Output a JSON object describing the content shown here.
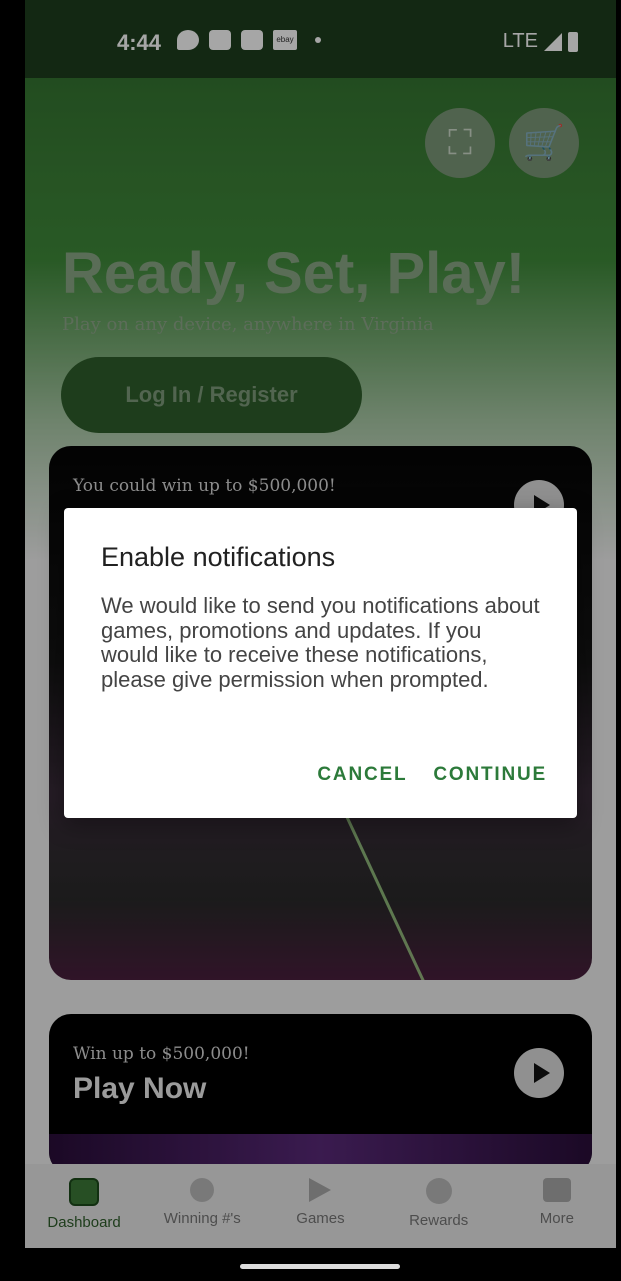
{
  "status_bar": {
    "time": "4:44",
    "network": "LTE",
    "icons": [
      "chat-bubble-icon",
      "message-icon",
      "app-icon",
      "ebay-icon"
    ],
    "ebay_label": "ebay"
  },
  "header": {
    "scan_icon": "scan-icon",
    "cart_icon": "cart-icon"
  },
  "hero": {
    "title": "Ready, Set, Play!",
    "subtitle": "Play on any device, anywhere in Virginia",
    "login_label": "Log In / Register"
  },
  "cards": [
    {
      "kicker": "You could win up to $500,000!",
      "title": ""
    },
    {
      "kicker": "Win up to $500,000!",
      "title": "Play Now"
    }
  ],
  "dialog": {
    "title": "Enable notifications",
    "body": "We would like to send you notifications about games, promotions and updates. If you would like to receive these notifications, please give permission when prompted.",
    "cancel_label": "CANCEL",
    "continue_label": "CONTINUE"
  },
  "bottom_nav": [
    {
      "label": "Dashboard",
      "icon": "dashboard-icon",
      "active": true
    },
    {
      "label": "Winning #'s",
      "icon": "lottery-ball-icon",
      "active": false
    },
    {
      "label": "Games",
      "icon": "games-play-icon",
      "active": false
    },
    {
      "label": "Rewards",
      "icon": "rewards-coin-icon",
      "active": false
    },
    {
      "label": "More",
      "icon": "treasure-chest-icon",
      "active": false
    }
  ],
  "colors": {
    "accent": "#2c7a3a",
    "header_green": "#3b7f36"
  }
}
